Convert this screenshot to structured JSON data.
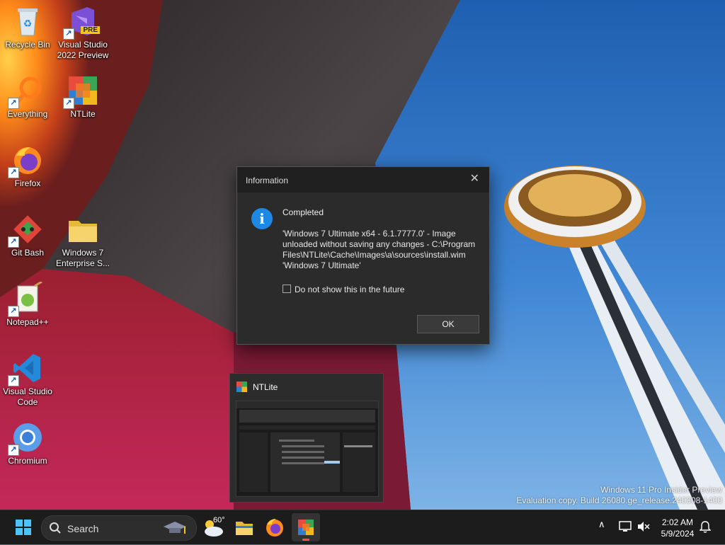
{
  "desktop_icons": [
    {
      "label": "Recycle Bin",
      "icon": "recycle-bin-icon"
    },
    {
      "label": "Visual Studio 2022 Preview",
      "line1": "Visual Studio",
      "line2": "2022 Preview",
      "badge": "PRE",
      "icon": "visual-studio-icon"
    },
    {
      "label": "Everything",
      "icon": "everything-search-icon"
    },
    {
      "label": "NTLite",
      "icon": "ntlite-icon"
    },
    {
      "label": "Firefox",
      "icon": "firefox-icon"
    },
    {
      "label": "Git Bash",
      "icon": "git-bash-icon"
    },
    {
      "label": "Windows 7 Enterprise S...",
      "line1": "Windows 7",
      "line2": "Enterprise S...",
      "icon": "folder-icon"
    },
    {
      "label": "Notepad++",
      "icon": "notepad-plus-plus-icon"
    },
    {
      "label": "Visual Studio Code",
      "line1": "Visual Studio",
      "line2": "Code",
      "icon": "vscode-icon"
    },
    {
      "label": "Chromium",
      "icon": "chromium-icon"
    }
  ],
  "dialog": {
    "title": "Information",
    "heading": "Completed",
    "message_lines": [
      "'Windows 7 Ultimate x64 - 6.1.7777.0' - Image",
      "unloaded without saving any changes - C:\\Program",
      "Files\\NTLite\\Cache\\Images\\a\\sources\\install.wim",
      "'Windows 7 Ultimate'"
    ],
    "checkbox_label": "Do not show this in the future",
    "checkbox_checked": false,
    "ok_label": "OK",
    "accent": "#1e88e5"
  },
  "preview": {
    "title": "NTLite"
  },
  "watermark": {
    "line1": "Windows 11 Pro Insider Preview",
    "line2": "Evaluation copy. Build 26080.ge_release.240308-1400"
  },
  "taskbar": {
    "search_placeholder": "Search",
    "weather_temp": "60°",
    "pinned": [
      "start-icon",
      "weather-icon",
      "file-explorer-icon",
      "firefox-icon",
      "ntlite-icon"
    ],
    "clock_time": "2:02 AM",
    "clock_date": "5/9/2024"
  }
}
